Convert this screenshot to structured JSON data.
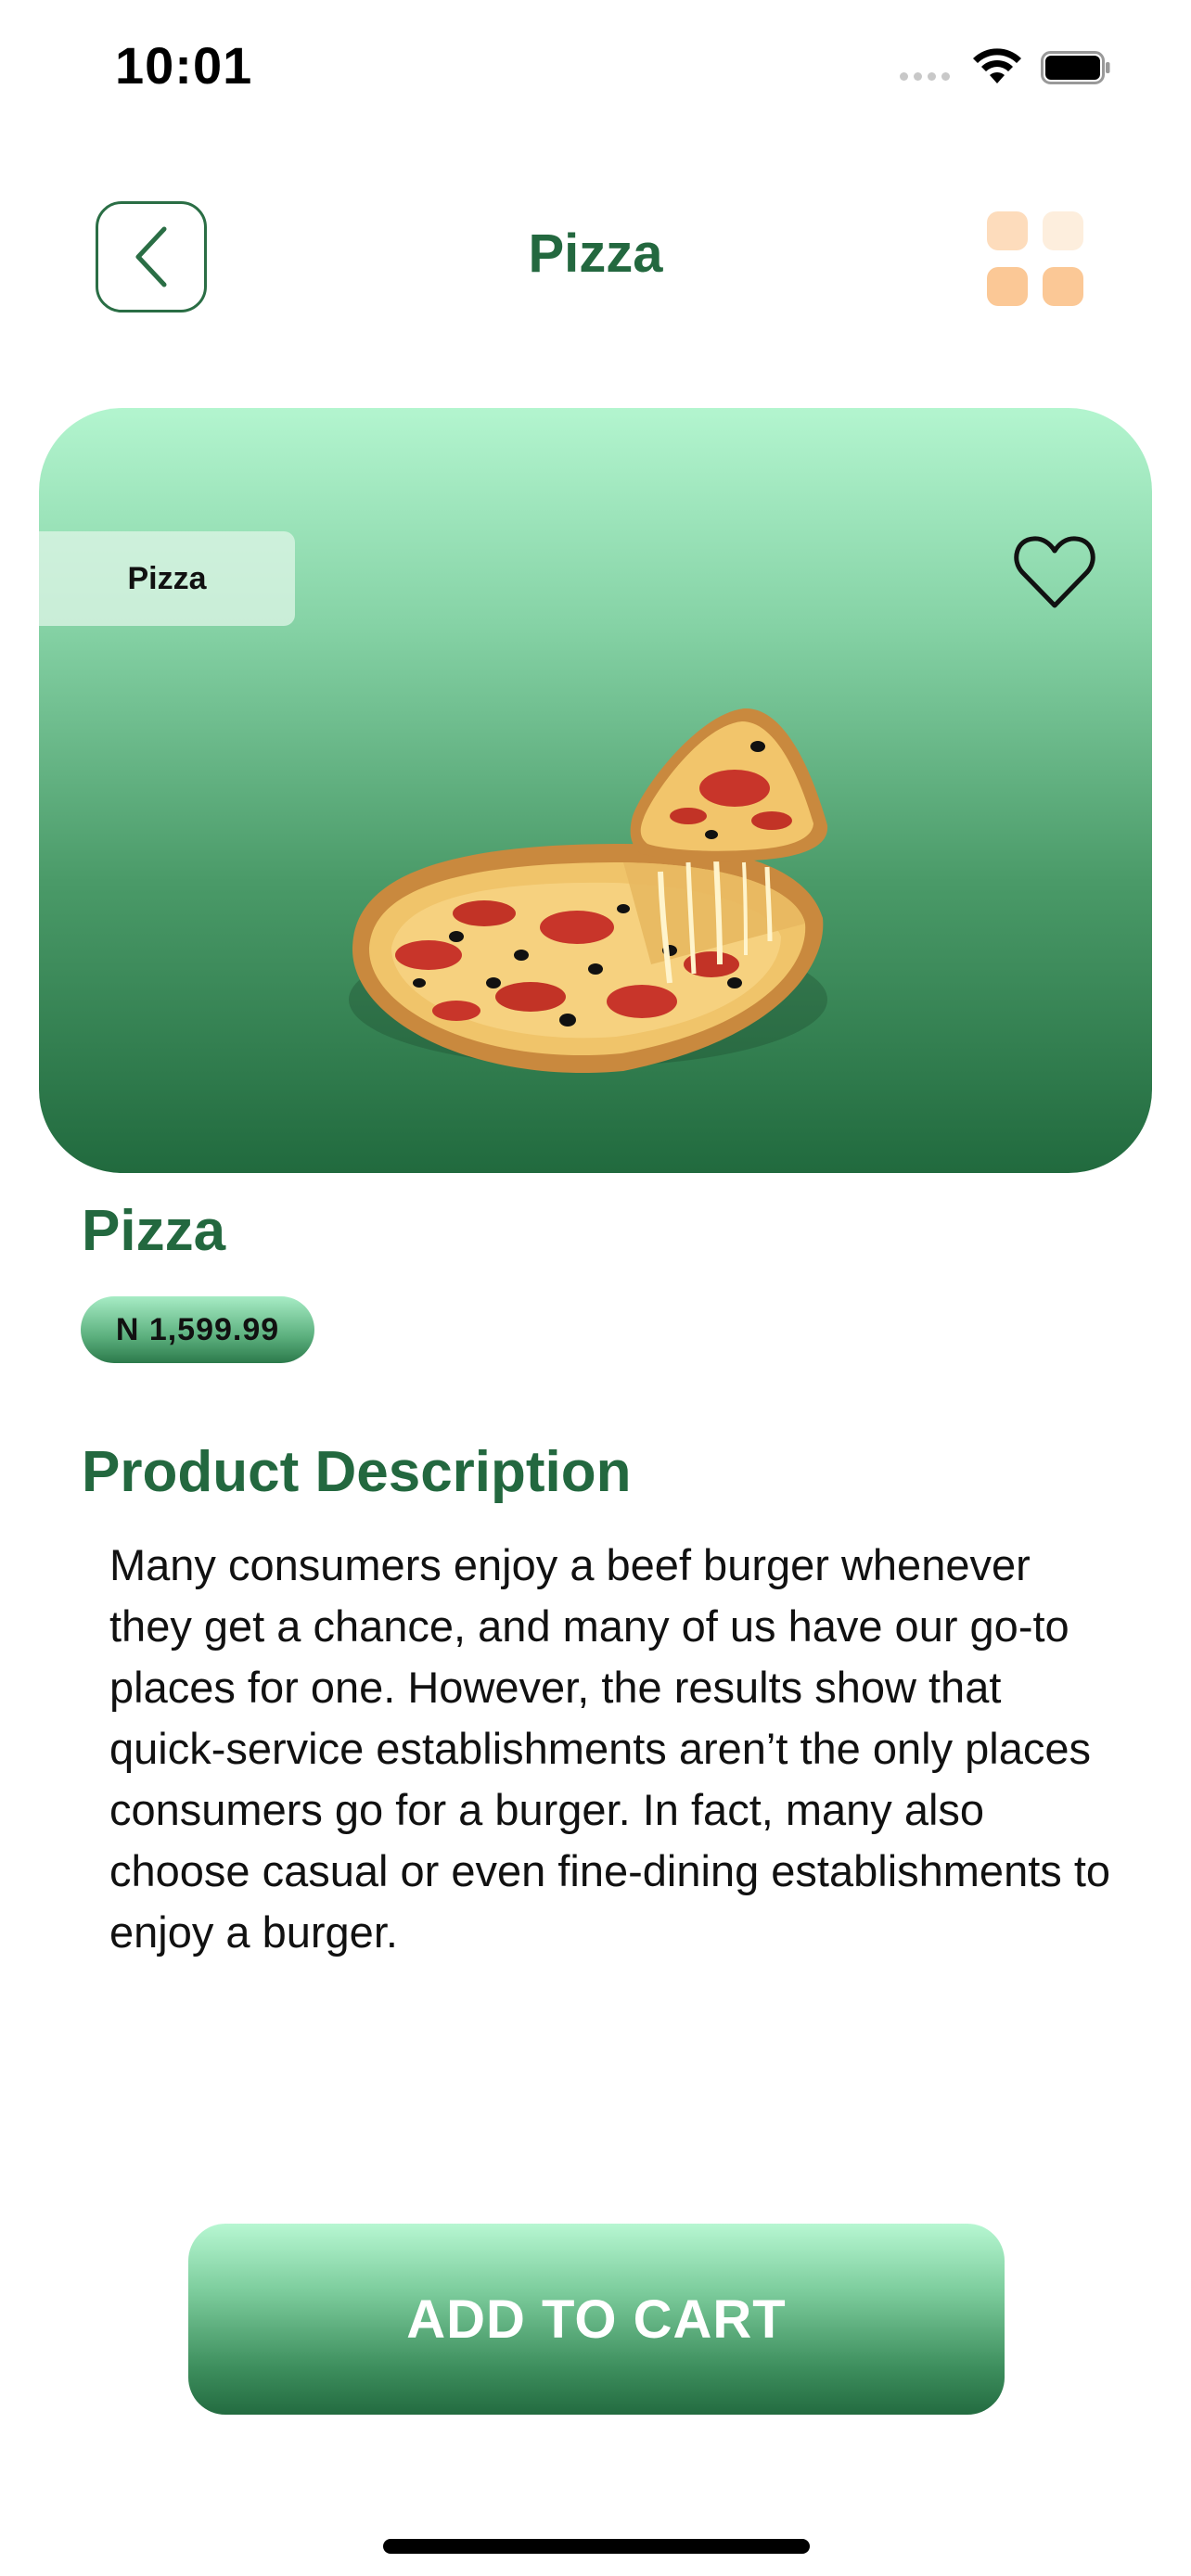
{
  "status_bar": {
    "time": "10:01"
  },
  "header": {
    "title": "Pizza",
    "back_icon": "chevron-left-icon",
    "menu_icon": "grid-icon"
  },
  "hero": {
    "category_chip": "Pizza",
    "favorite_icon": "heart-outline-icon",
    "image": "pizza-image"
  },
  "product": {
    "name": "Pizza",
    "price": "N 1,599.99"
  },
  "description": {
    "heading": "Product Description",
    "body": "Many consumers enjoy a beef burger whenever they get a chance, and many of us have our go-to places for one. However, the results show that quick-service establishments aren’t the only places consumers go for a burger. In fact, many also choose casual or even fine-dining establishments to enjoy a burger."
  },
  "actions": {
    "add_to_cart": "ADD TO CART"
  },
  "colors": {
    "brand_green": "#23683f",
    "gradient_light": "#b3f5cf",
    "gradient_dark": "#216a3e",
    "grid_icon_orange": "#fbc896"
  }
}
